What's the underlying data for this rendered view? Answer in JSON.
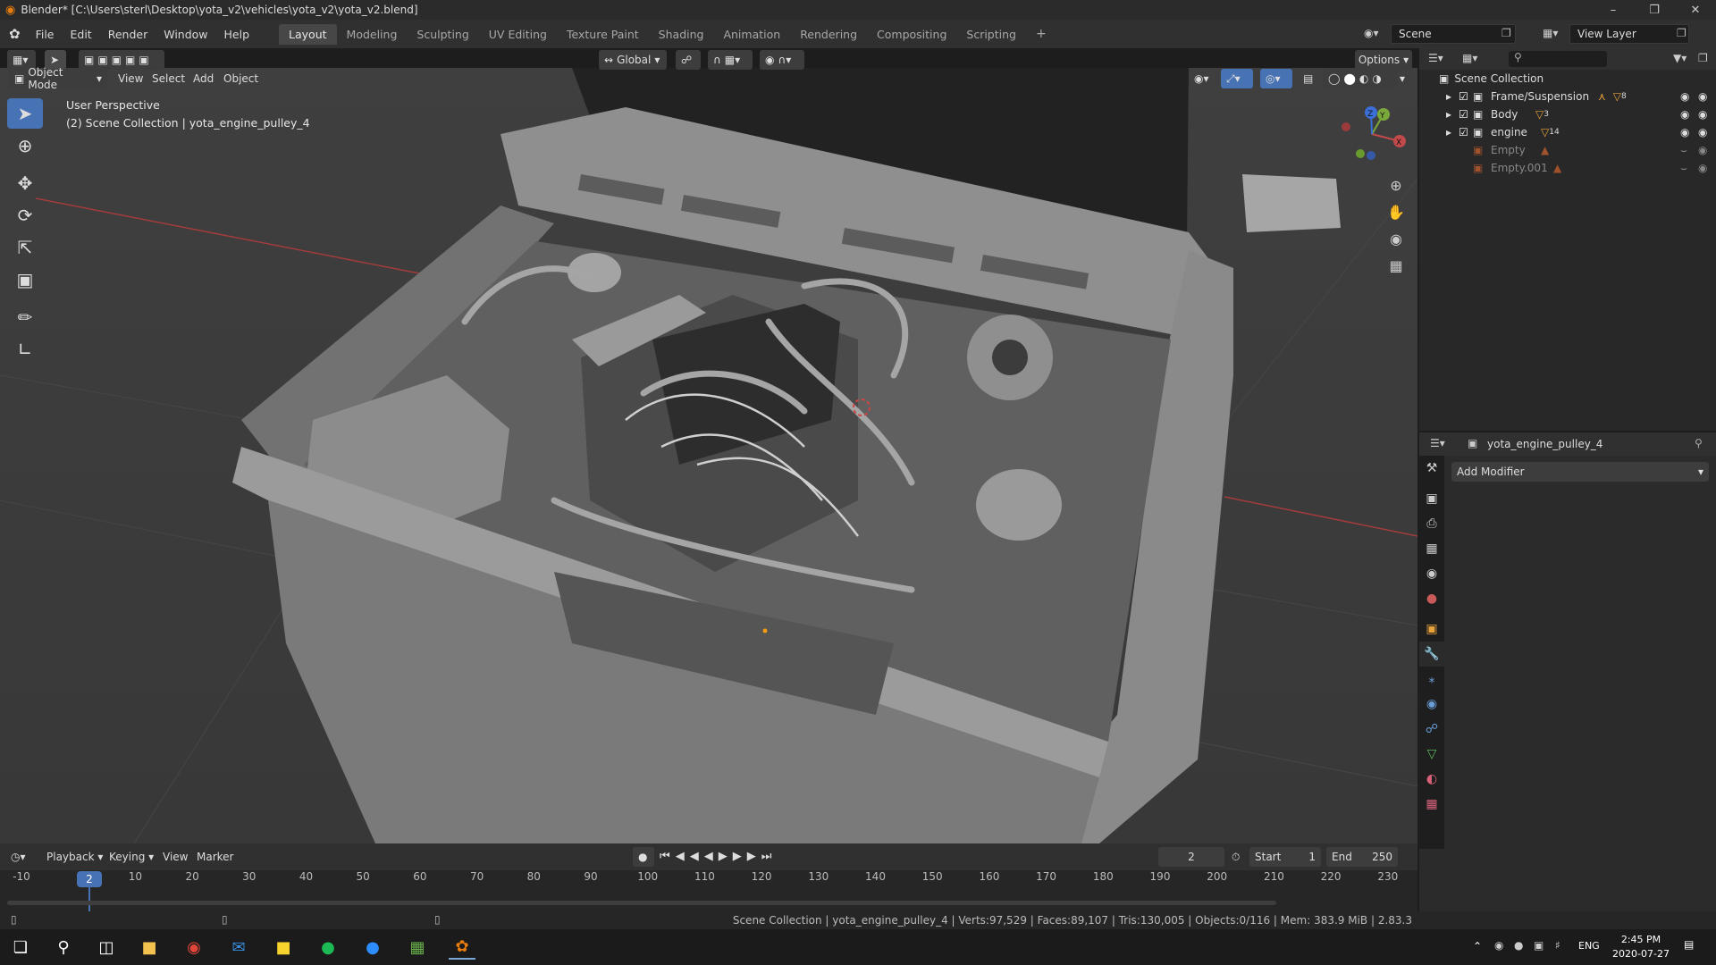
{
  "titlebar": {
    "title": "Blender* [C:\\Users\\sterl\\Desktop\\yota_v2\\vehicles\\yota_v2\\yota_v2.blend]",
    "min": "–",
    "max": "❐",
    "close": "✕"
  },
  "menu": {
    "items": [
      "File",
      "Edit",
      "Render",
      "Window",
      "Help"
    ],
    "workspaces": [
      "Layout",
      "Modeling",
      "Sculpting",
      "UV Editing",
      "Texture Paint",
      "Shading",
      "Animation",
      "Rendering",
      "Compositing",
      "Scripting"
    ],
    "active_workspace": "Layout",
    "add_tab": "+",
    "scene": "Scene",
    "view_layer": "View Layer"
  },
  "viewport_header": {
    "mode": "Object Mode",
    "menus": [
      "View",
      "Select",
      "Add",
      "Object"
    ],
    "transform": "Global",
    "options": "Options"
  },
  "viewport": {
    "perspective": "User Perspective",
    "collection": "(2) Scene Collection | yota_engine_pulley_4"
  },
  "gizmo": {
    "x": "X",
    "y": "Y",
    "z": "Z"
  },
  "outliner": {
    "root": "Scene Collection",
    "rows": [
      {
        "name": "Frame/Suspension",
        "badge": "8",
        "visible": true
      },
      {
        "name": "Body",
        "badge": "3",
        "visible": true
      },
      {
        "name": "engine",
        "badge": "14",
        "visible": true
      },
      {
        "name": "Empty",
        "badge": "",
        "visible": false
      },
      {
        "name": "Empty.001",
        "badge": "",
        "visible": false
      }
    ]
  },
  "properties": {
    "object_name": "yota_engine_pulley_4",
    "add_modifier": "Add Modifier"
  },
  "timeline": {
    "menus": [
      "Playback",
      "Keying",
      "View",
      "Marker"
    ],
    "current_frame": "2",
    "start_label": "Start",
    "start": "1",
    "end_label": "End",
    "end": "250",
    "ticks": [
      "-10",
      "2",
      "10",
      "20",
      "30",
      "40",
      "50",
      "60",
      "70",
      "80",
      "90",
      "100",
      "110",
      "120",
      "130",
      "140",
      "150",
      "160",
      "170",
      "180",
      "190",
      "200",
      "210",
      "220",
      "230"
    ]
  },
  "status": {
    "text": "Scene Collection | yota_engine_pulley_4 | Verts:97,529 | Faces:89,107 | Tris:130,005 | Objects:0/116 | Mem: 383.9 MiB | 2.83.3"
  },
  "taskbar": {
    "lang": "ENG",
    "time": "2:45 PM",
    "date": "2020-07-27"
  },
  "colors": {
    "accent": "#4772b3",
    "x_axis": "#c24a4a",
    "y_axis": "#7aa83a",
    "z_axis": "#3a6fd8"
  }
}
